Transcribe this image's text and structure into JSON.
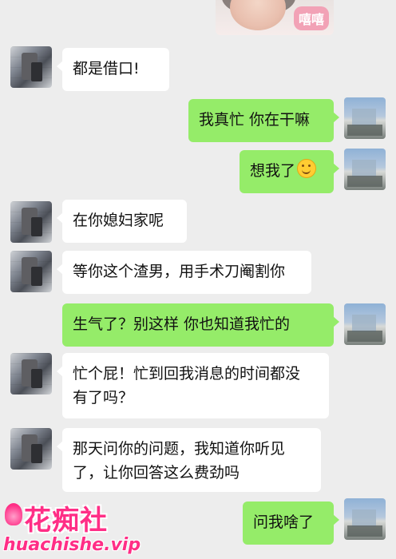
{
  "sticker": {
    "label": "嘻嘻"
  },
  "messages": [
    {
      "side": "in",
      "text": "都是借口!"
    },
    {
      "side": "out",
      "text": "我真忙 你在干嘛"
    },
    {
      "side": "out",
      "text": "想我了",
      "emoji": "smiling-face-icon"
    },
    {
      "side": "in",
      "text": "在你媳妇家呢"
    },
    {
      "side": "in",
      "text": "等你这个渣男，用手术刀阉割你"
    },
    {
      "side": "out",
      "text": "生气了？别这样 你也知道我忙的"
    },
    {
      "side": "in",
      "line1": "忙个屁！忙到回我消息的时间都没",
      "line2": "有了吗？"
    },
    {
      "side": "in",
      "line1": "那天问你的问题，我知道你听见",
      "line2": "了，让你回答这么费劲吗"
    },
    {
      "side": "out",
      "text": "问我啥了"
    }
  ],
  "watermark": {
    "cn": "花痴社",
    "en": "huachishe.vip"
  },
  "colors": {
    "background": "#ededed",
    "incoming": "#ffffff",
    "outgoing": "#95ec69",
    "watermark": "#ff2e86"
  }
}
